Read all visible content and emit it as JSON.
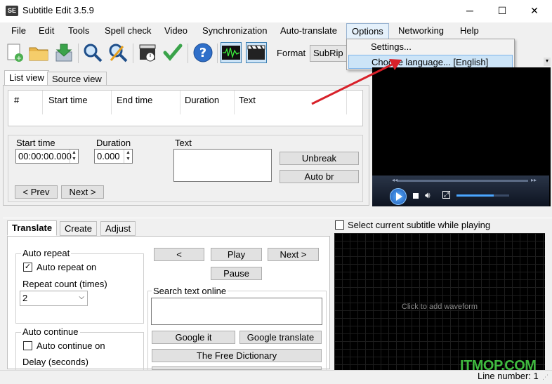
{
  "window": {
    "title": "Subtitle Edit 3.5.9",
    "icon_text": "SE",
    "minimize": "─",
    "maximize": "☐",
    "close": "✕"
  },
  "menu": {
    "items": [
      "File",
      "Edit",
      "Tools",
      "Spell check",
      "Video",
      "Synchronization",
      "Auto-translate",
      "Options",
      "Networking",
      "Help"
    ]
  },
  "options_menu": {
    "settings": "Settings...",
    "choose_language": "Choose language... [English]"
  },
  "toolbar": {
    "format_label": "Format",
    "format_value": "SubRip (.srt)",
    "icons": [
      "new-file-icon",
      "open-folder-icon",
      "save-icon",
      "find-icon",
      "replace-icon",
      "visual-sync-icon",
      "spell-check-icon",
      "help-icon",
      "waveform-toggle-icon",
      "video-toggle-icon"
    ]
  },
  "list_tabs": [
    "List view",
    "Source view"
  ],
  "subtitle_table": {
    "columns": [
      "#",
      "Start time",
      "End time",
      "Duration",
      "Text"
    ]
  },
  "editor": {
    "start_time_label": "Start time",
    "start_time_value": "00:00:00.000",
    "duration_label": "Duration",
    "duration_value": "0.000",
    "text_label": "Text",
    "unbreak": "Unbreak",
    "auto_br": "Auto br",
    "prev": "< Prev",
    "next": "Next >"
  },
  "bottom_tabs": [
    "Translate",
    "Create",
    "Adjust"
  ],
  "translate": {
    "auto_repeat_group": "Auto repeat",
    "auto_repeat_on": "Auto repeat on",
    "repeat_count_label": "Repeat count (times)",
    "repeat_count_value": "2",
    "auto_continue_group": "Auto continue",
    "auto_continue_on": "Auto continue on",
    "delay_label": "Delay (seconds)",
    "prev_btn": "<",
    "play_btn": "Play",
    "next_btn": "Next >",
    "pause_btn": "Pause",
    "search_online_label": "Search text online",
    "google_it": "Google it",
    "google_translate": "Google translate",
    "free_dictionary": "The Free Dictionary"
  },
  "waveform": {
    "select_current_label": "Select current subtitle while playing",
    "placeholder": "Click to add waveform"
  },
  "status": {
    "line_number": "Line number: 1"
  },
  "watermark": "ITMOP.COM"
}
